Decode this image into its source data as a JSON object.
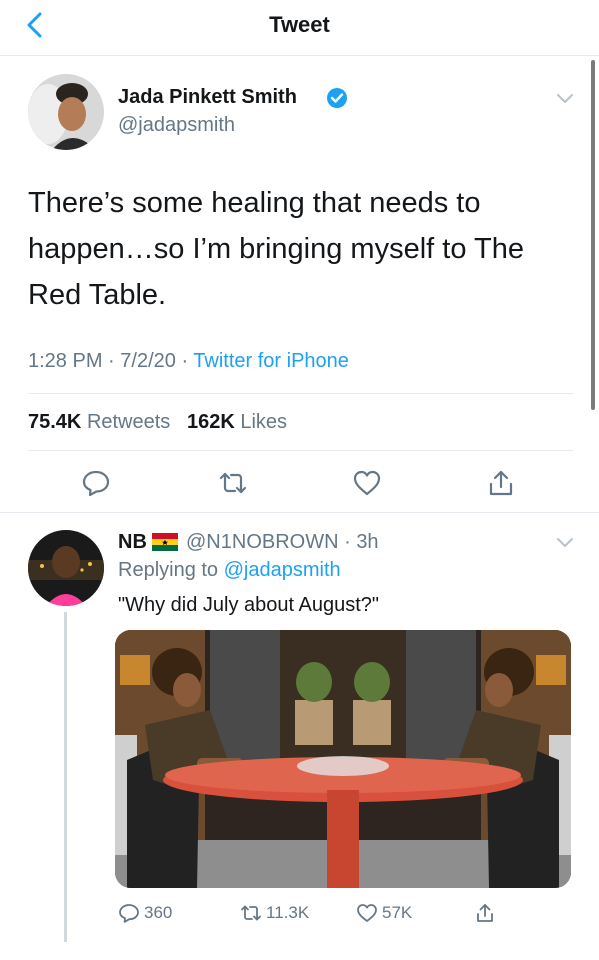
{
  "nav": {
    "title": "Tweet"
  },
  "tweet": {
    "author_name": "Jada Pinkett Smith",
    "author_handle": "@jadapsmith",
    "text": "There’s some healing that needs to happen…so I’m bringing myself to The Red Table.",
    "time": "1:28 PM",
    "date": "7/2/20",
    "source": "Twitter for iPhone",
    "retweets_count": "75.4K",
    "retweets_label": "Retweets",
    "likes_count": "162K",
    "likes_label": "Likes"
  },
  "reply": {
    "name": "NB",
    "handle": "@N1NOBROWN",
    "age": "3h",
    "replying_label": "Replying to",
    "replying_to": "@jadapsmith",
    "text": "\"Why did July about August?\"",
    "reply_count": "360",
    "retweet_count": "11.3K",
    "like_count": "57K"
  },
  "colors": {
    "accent": "#1da1f2",
    "secondary_text": "#657786",
    "divider": "#e6ecf0",
    "table_red": "#d9503c"
  }
}
